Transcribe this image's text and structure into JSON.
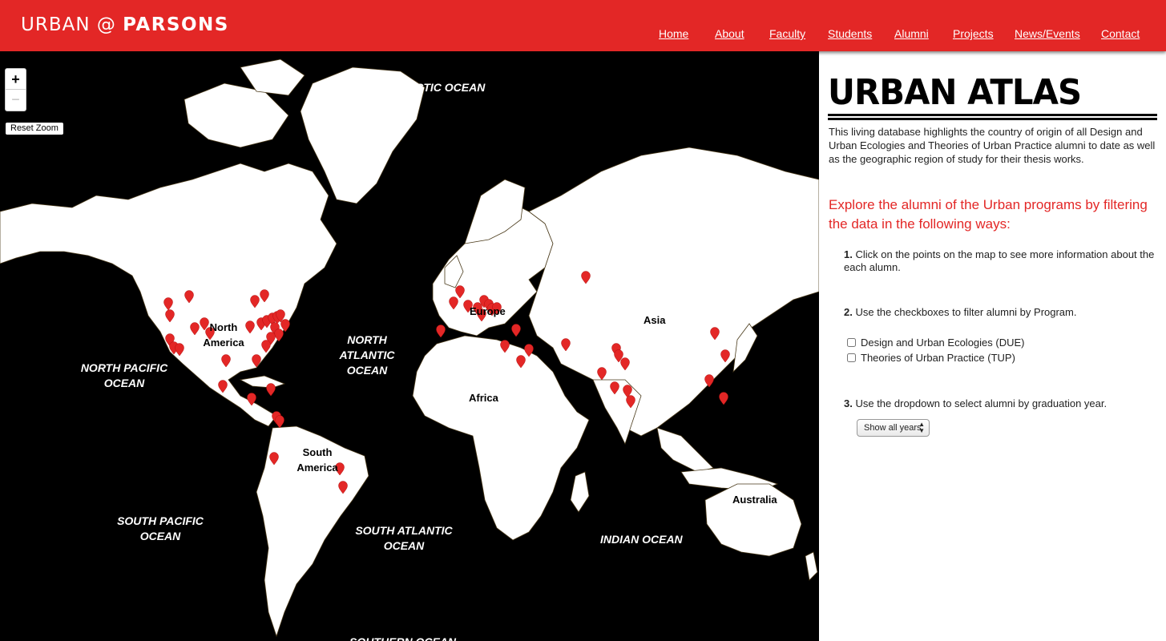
{
  "header": {
    "logo_light": "URBAN @ ",
    "logo_bold": "PARSONS",
    "nav": [
      "Home",
      "About",
      "Faculty",
      "Students",
      "Alumni",
      "Projects",
      "News/Events",
      "Contact"
    ]
  },
  "map": {
    "zoom_in": "+",
    "zoom_out": "−",
    "reset_zoom": "Reset Zoom",
    "ocean_labels": [
      "ARCTIC OCEAN",
      "NORTH ATLANTIC OCEAN",
      "NORTH PACIFIC OCEAN",
      "SOUTH PACIFIC OCEAN",
      "SOUTH ATLANTIC OCEAN",
      "INDIAN OCEAN",
      "SOUTHERN OCEAN"
    ],
    "continent_labels": [
      "North America",
      "South America",
      "Europe",
      "Africa",
      "Asia",
      "Australia"
    ],
    "marker_color": "#e32726"
  },
  "sidebar": {
    "title": "URBAN ATLAS",
    "intro": "This living database highlights the country of origin of all Design and Urban Ecologies and Theories of Urban Practice alumni to date as well as the geographic region of study for their thesis works.",
    "explore": "Explore the alumni of the Urban programs by filtering the data in the following ways:",
    "step1_num": "1.",
    "step1_text": "Click on the points on the map to see more information about the each alumn.",
    "step2_num": "2.",
    "step2_text": "Use the checkboxes to filter alumni by Program.",
    "program_due": "Design and Urban Ecologies (DUE)",
    "program_tup": "Theories of Urban Practice (TUP)",
    "step3_num": "3.",
    "step3_text": "Use the dropdown to select alumni by graduation year.",
    "year_select": "Show all years"
  },
  "colors": {
    "brand": "#e32726",
    "map_bg": "#000000",
    "land": "#ffffff"
  }
}
